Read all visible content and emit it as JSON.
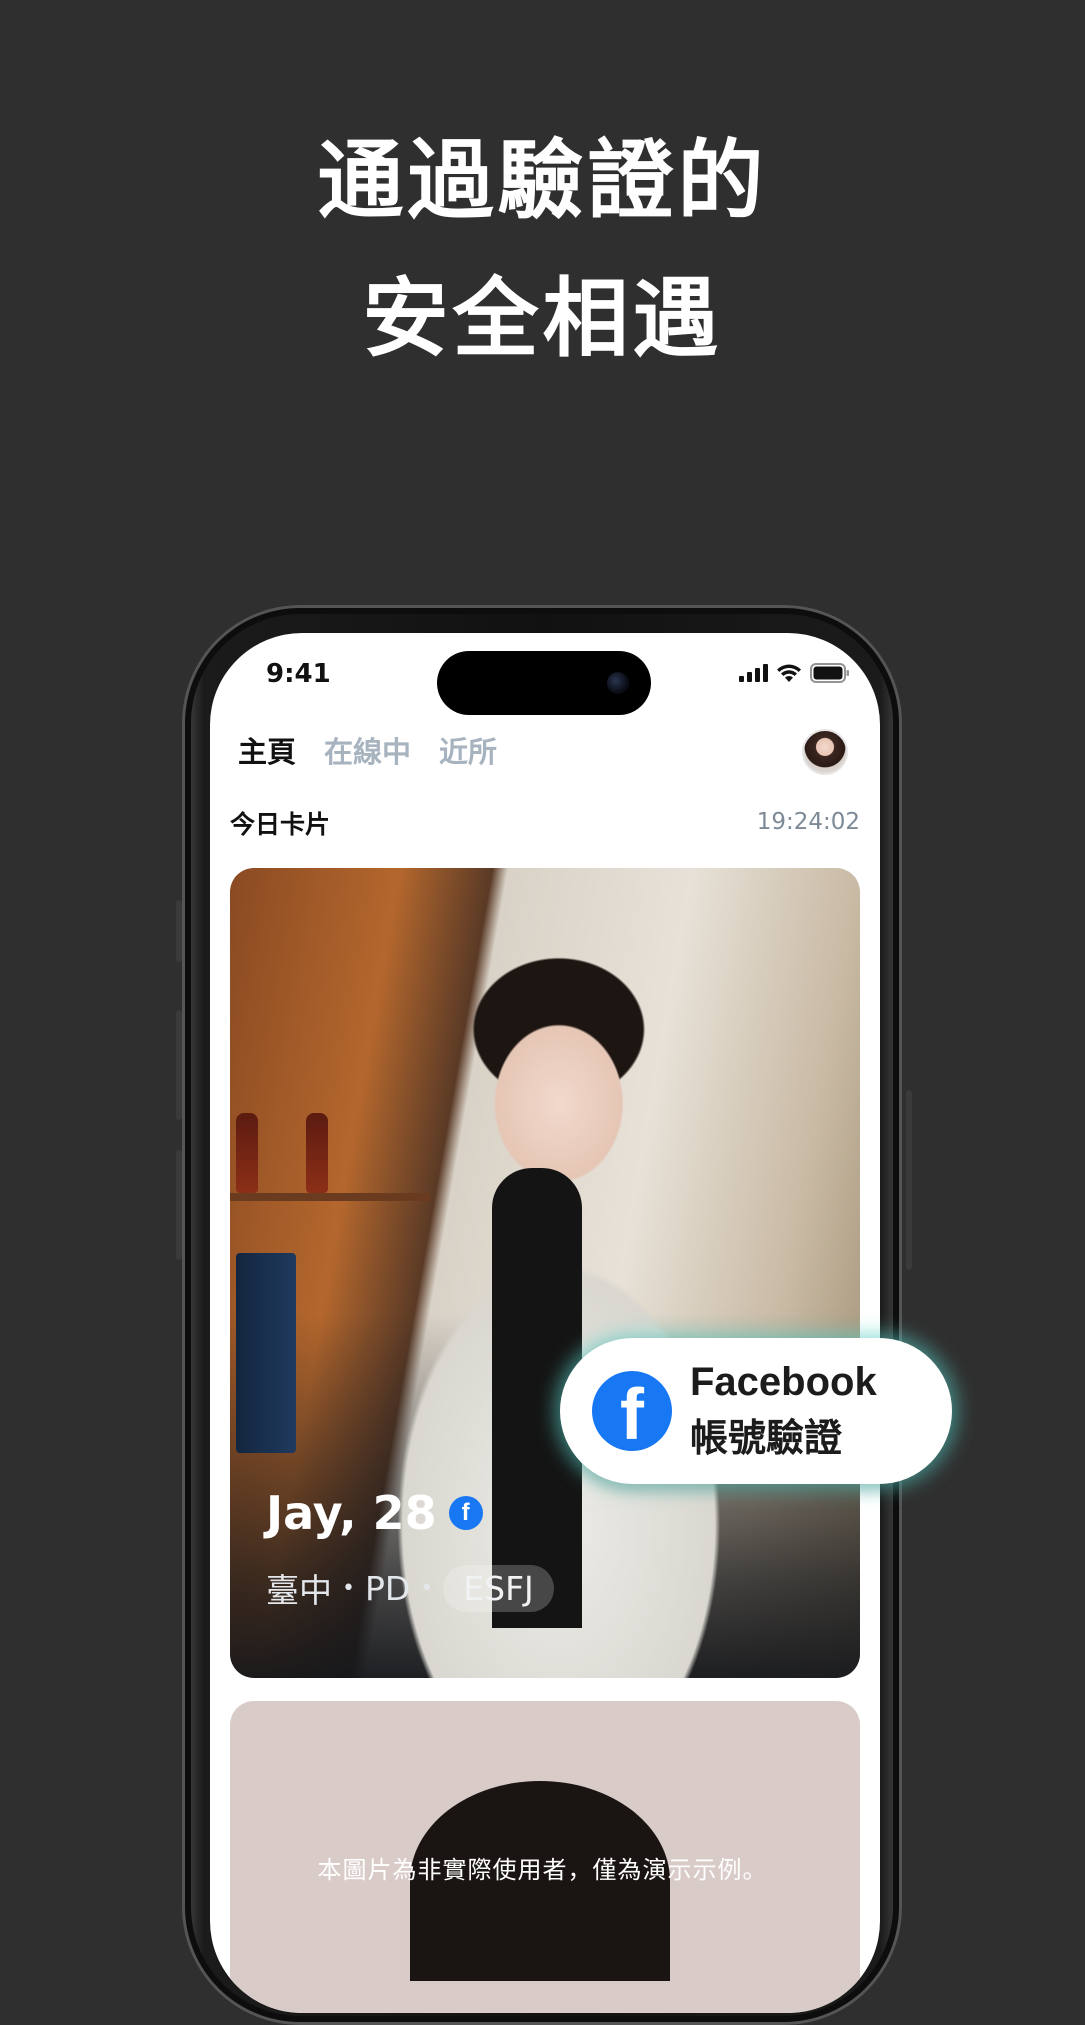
{
  "headline": {
    "line1": "通過驗證的",
    "line2": "安全相遇"
  },
  "status_bar": {
    "time": "9:41"
  },
  "nav": {
    "tabs": [
      "主頁",
      "在線中",
      "近所"
    ]
  },
  "today": {
    "title": "今日卡片",
    "countdown": "19:24:02"
  },
  "profile_card": {
    "name": "Jay, 28",
    "badge": "f",
    "city": "臺中",
    "job": "PD",
    "separator": "•",
    "mbti": "ESFJ"
  },
  "verify_callout": {
    "logo": "f",
    "line1": "Facebook",
    "line2": "帳號驗證"
  },
  "disclaimer": "本圖片為非實際使用者，僅為演示示例。",
  "colors": {
    "background": "#2f2f2f",
    "facebook_blue": "#1877f2",
    "glow": "#5fd7cd"
  }
}
